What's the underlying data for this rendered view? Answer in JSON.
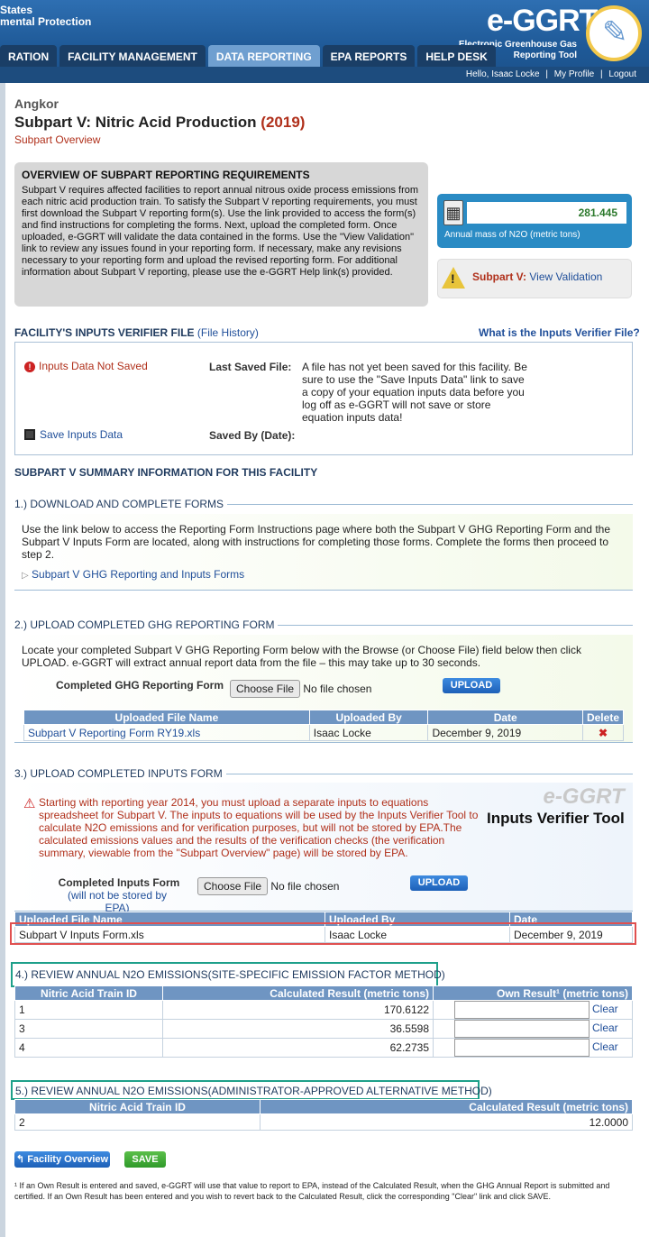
{
  "header": {
    "agency_line1": "States",
    "agency_line2": "mental Protection",
    "logo": "e-GGRT",
    "logo_sub1": "Electronic Greenhouse Gas",
    "logo_sub2": "Reporting Tool"
  },
  "nav": {
    "tabs": [
      "RATION",
      "FACILITY MANAGEMENT",
      "DATA REPORTING",
      "EPA REPORTS",
      "HELP DESK"
    ]
  },
  "userbar": {
    "hello": "Hello, Isaac Locke",
    "sep": "|",
    "profile": "My Profile",
    "logout": "Logout"
  },
  "page": {
    "facility": "Angkor",
    "title": "Subpart V: Nitric Acid Production",
    "year": "(2019)",
    "subtitle": "Subpart Overview"
  },
  "overview": {
    "heading": "OVERVIEW OF SUBPART REPORTING REQUIREMENTS",
    "text": "Subpart V requires affected facilities to report annual nitrous oxide process emissions from each nitric acid production train. To satisfy the Subpart V reporting requirements, you must first download the Subpart V reporting form(s). Use the link provided to access the form(s) and find instructions for completing the forms. Next, upload the completed form. Once uploaded, e-GGRT will validate the data contained in the forms. Use the \"View Validation\" link to review any issues found in your reporting form. If necessary, make any revisions necessary to your reporting form and upload the revised reporting form. For additional information about Subpart V reporting, please use the e-GGRT Help link(s) provided."
  },
  "mass": {
    "value": "281.445",
    "label": "Annual mass of N2O (metric tons)"
  },
  "validation": {
    "label": "Subpart V:",
    "link": "View Validation"
  },
  "verifier": {
    "heading": "FACILITY'S INPUTS VERIFIER FILE",
    "history": "(File History)",
    "what": "What is the Inputs Verifier File?",
    "status": "Inputs Data Not Saved",
    "last_saved": "Last Saved File:",
    "message": "A file has not yet been saved for this facility. Be sure to use the \"Save Inputs Data\" link to save a copy of your equation inputs data before you log off as e-GGRT will not save or store equation inputs data!",
    "save_link": "Save Inputs Data",
    "saved_by": "Saved By (Date):"
  },
  "summary": {
    "heading": "SUBPART V SUMMARY INFORMATION FOR THIS FACILITY"
  },
  "step1": {
    "title": "1.) DOWNLOAD AND COMPLETE FORMS",
    "text": "Use the link below to access the Reporting Form Instructions page where both the Subpart V GHG Reporting Form and the Subpart V Inputs Form are located, along with instructions for completing those forms. Complete the forms then proceed to step 2.",
    "link": "Subpart V GHG Reporting and Inputs Forms"
  },
  "step2": {
    "title": "2.) UPLOAD COMPLETED GHG REPORTING FORM",
    "text": "Locate your completed Subpart V GHG Reporting Form below with the Browse (or Choose File) field below then click UPLOAD. e-GGRT will extract annual report data from the file – this may take up to 30 seconds.",
    "form_label": "Completed GHG Reporting Form",
    "choose": "Choose File",
    "nofile": "No file chosen",
    "upload": "UPLOAD",
    "columns": [
      "Uploaded File Name",
      "Uploaded By",
      "Date",
      "Delete"
    ],
    "row": {
      "file": "Subpart V Reporting Form RY19.xls",
      "by": "Isaac Locke",
      "date": "December 9, 2019",
      "del": "✖"
    }
  },
  "step3": {
    "title": "3.) UPLOAD COMPLETED INPUTS FORM",
    "warning": "Starting with reporting year 2014, you must upload a separate inputs to equations spreadsheet for Subpart V. The inputs to equations will be used by the Inputs Verifier Tool to calculate N2O emissions and for verification purposes, but will not be stored by EPA.The calculated emissions values and the results of the verification checks (the verification summary, viewable from the \"Subpart Overview\" page) will be stored by EPA.",
    "logo_a": "e-GGRT",
    "logo_b": "Inputs Verifier Tool",
    "form_label": "Completed Inputs Form",
    "form_note": "(will not be stored by EPA)",
    "choose": "Choose File",
    "nofile": "No file chosen",
    "upload": "UPLOAD",
    "columns": [
      "Uploaded File Name",
      "Uploaded By",
      "Date"
    ],
    "row": {
      "file": "Subpart V Inputs Form.xls",
      "by": "Isaac Locke",
      "date": "December 9, 2019"
    }
  },
  "step4": {
    "title": "4.) REVIEW ANNUAL N2O EMISSIONS(SITE-SPECIFIC EMISSION FACTOR METHOD)",
    "columns": [
      "Nitric Acid Train ID",
      "Calculated Result (metric tons)",
      "Own Result¹ (metric tons)"
    ],
    "rows": [
      {
        "id": "1",
        "calc": "170.6122",
        "clear": "Clear"
      },
      {
        "id": "3",
        "calc": "36.5598",
        "clear": "Clear"
      },
      {
        "id": "4",
        "calc": "62.2735",
        "clear": "Clear"
      }
    ]
  },
  "step5": {
    "title": "5.) REVIEW ANNUAL N2O EMISSIONS(ADMINISTRATOR-APPROVED ALTERNATIVE METHOD)",
    "columns": [
      "Nitric Acid Train ID",
      "Calculated Result (metric tons)"
    ],
    "rows": [
      {
        "id": "2",
        "calc": "12.0000"
      }
    ]
  },
  "buttons": {
    "overview": "Facility Overview",
    "save": "SAVE"
  },
  "footnote": "¹ If an Own Result is entered and saved, e-GGRT will use that value to report to EPA, instead of the Calculated Result, when the GHG Annual Report is submitted and certified. If an Own Result has been entered and you wish to revert back to the Calculated Result, click the corresponding \"Clear\" link and click SAVE."
}
